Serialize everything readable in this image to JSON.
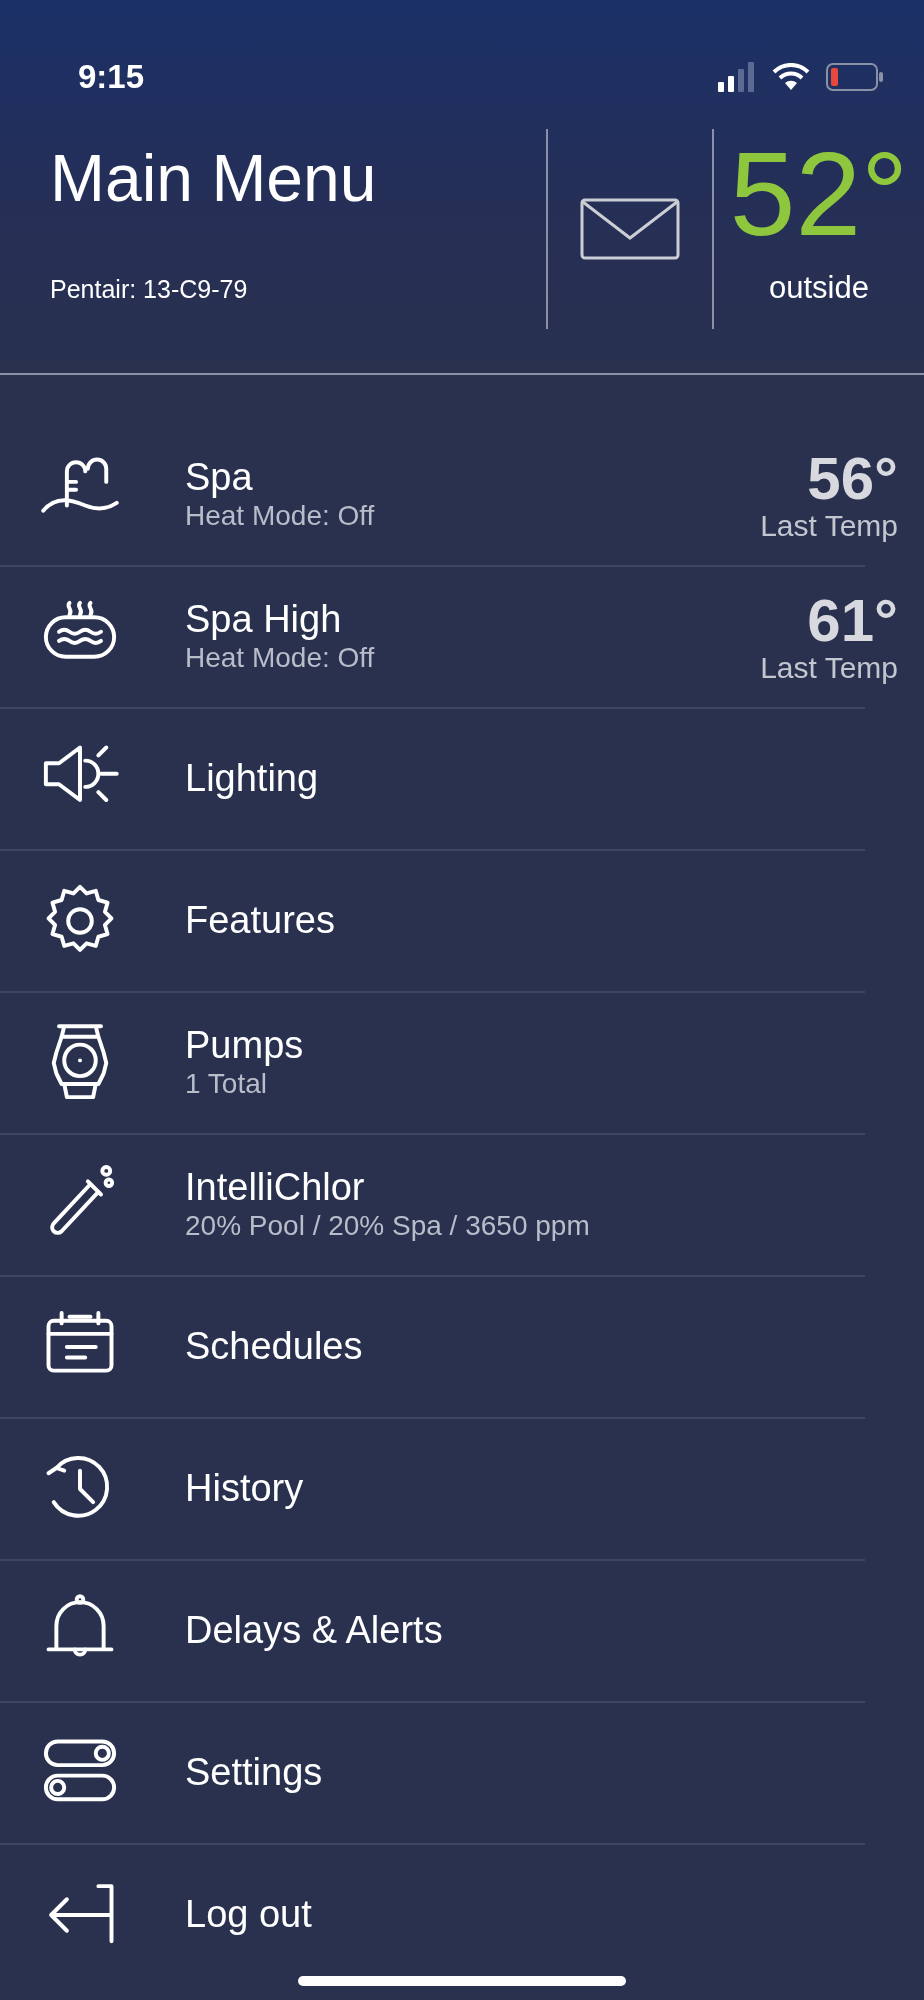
{
  "status_bar": {
    "time": "9:15"
  },
  "header": {
    "title": "Main Menu",
    "subtitle": "Pentair: 13-C9-79",
    "temperature": "52°",
    "temperature_label": "outside"
  },
  "menu": [
    {
      "title": "Spa",
      "subtitle": "Heat Mode: Off",
      "temp": "56°",
      "temp_label": "Last Temp"
    },
    {
      "title": "Spa High",
      "subtitle": "Heat Mode: Off",
      "temp": "61°",
      "temp_label": "Last Temp"
    },
    {
      "title": "Lighting"
    },
    {
      "title": "Features"
    },
    {
      "title": "Pumps",
      "subtitle": "1 Total"
    },
    {
      "title": "IntelliChlor",
      "subtitle": "20% Pool / 20% Spa / 3650 ppm"
    },
    {
      "title": "Schedules"
    },
    {
      "title": "History"
    },
    {
      "title": "Delays & Alerts"
    },
    {
      "title": "Settings"
    },
    {
      "title": "Log out"
    }
  ]
}
